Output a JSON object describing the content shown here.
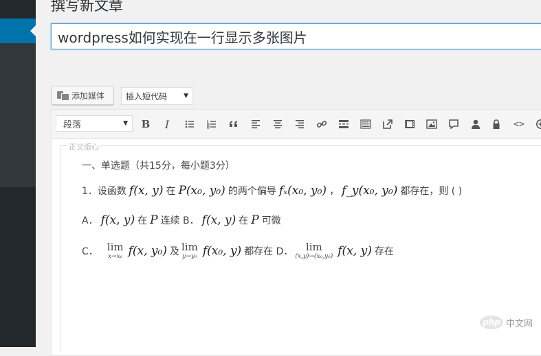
{
  "page": {
    "heading": "撰写新文章",
    "post_title": "wordpress如何实现在一行显示多张图片"
  },
  "media": {
    "add_media_label": "添加媒体",
    "insert_shortcode_label": "插入短代码"
  },
  "editor": {
    "format_value": "段落",
    "toolbar_icons": [
      "bold-icon",
      "italic-icon",
      "bullet-list-icon",
      "numbered-list-icon",
      "blockquote-icon",
      "align-left-icon",
      "align-center-icon",
      "align-right-icon",
      "link-icon",
      "read-more-icon",
      "toolbar-toggle-icon",
      "external-link-icon",
      "video-icon",
      "image-icon",
      "comment-icon",
      "user-icon",
      "lock-icon",
      "code-icon",
      "plus-circle-icon"
    ],
    "bold_label": "B",
    "italic_label": "I",
    "code_label": "<>"
  },
  "content": {
    "legend": "正文版心",
    "line1": "一、单选题（共15分，每小题3分）",
    "line2": {
      "prefix": "1．设函数",
      "f1": "f(x, y)",
      "t1": "在",
      "p1": "P(x₀, y₀)",
      "t2": "的两个偏导",
      "fx": "fₓ(x₀, y₀)",
      "sep": "，",
      "fy": "f_y(x₀, y₀)",
      "t3": "都存在，则 ( )"
    },
    "line3": {
      "a": "A．",
      "f1": "f(x, y)",
      "t1": "在",
      "p1": "P",
      "t2": "连续 B．",
      "f2": "f(x, y)",
      "t3": "在",
      "p2": "P",
      "t4": "可微"
    },
    "line4": {
      "c": "C．",
      "lim": "lim",
      "sub1": "x→x₀",
      "f1": "f(x, y₀)",
      "t1": "及",
      "sub2": "y→y₀",
      "f2": "f(x₀, y)",
      "t2": "都存在 D．",
      "sub3": "(x,y)→(x₀,y₀)",
      "f3": "f(x, y)",
      "t3": "存在"
    }
  },
  "watermark": {
    "logo": "php",
    "text": "中文网"
  }
}
